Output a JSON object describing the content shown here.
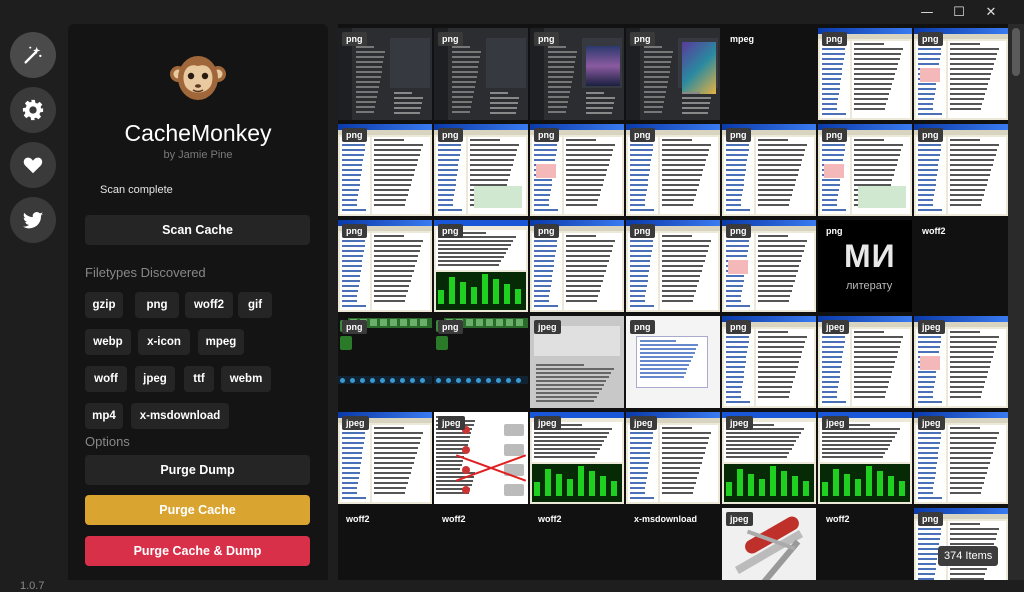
{
  "window": {
    "minimize_label": "—",
    "maximize_label": "☐",
    "close_label": "✕"
  },
  "rail": {
    "items": [
      {
        "name": "magic-wand-icon",
        "glyph": "wand"
      },
      {
        "name": "gear-icon",
        "glyph": "gear"
      },
      {
        "name": "heart-icon",
        "glyph": "heart"
      },
      {
        "name": "twitter-icon",
        "glyph": "bird"
      }
    ],
    "version": "1.0.7"
  },
  "panel": {
    "app_name": "CacheMonkey",
    "byline": "by Jamie Pine",
    "status": "Scan complete",
    "scan_button": "Scan Cache",
    "filetypes_heading": "Filetypes Discovered",
    "filetypes": [
      "gzip",
      "png",
      "woff2",
      "gif",
      "webp",
      "x-icon",
      "mpeg",
      "woff",
      "jpeg",
      "ttf",
      "webm",
      "mp4",
      "x-msdownload"
    ],
    "options_heading": "Options",
    "purge_dump": "Purge Dump",
    "purge_cache": "Purge Cache",
    "purge_cache_dump": "Purge Cache & Dump"
  },
  "colors": {
    "purge_cache_bg": "#d9a530",
    "purge_dump_bg": "#d9304a",
    "panel_bg": "#141414"
  },
  "grid": {
    "rows": [
      [
        {
          "t": "png",
          "k": "dark"
        },
        {
          "t": "png",
          "k": "dark"
        },
        {
          "t": "png",
          "k": "dark"
        },
        {
          "t": "png",
          "k": "dark"
        },
        {
          "t": "mpeg",
          "k": "black"
        },
        {
          "t": "png",
          "k": "xp"
        },
        {
          "t": "png",
          "k": "xp"
        }
      ],
      [
        {
          "t": "png",
          "k": "xp"
        },
        {
          "t": "png",
          "k": "xp"
        },
        {
          "t": "png",
          "k": "xp"
        },
        {
          "t": "png",
          "k": "xp"
        },
        {
          "t": "png",
          "k": "xp"
        },
        {
          "t": "png",
          "k": "xp"
        },
        {
          "t": "png",
          "k": "xp"
        }
      ],
      [
        {
          "t": "png",
          "k": "xp"
        },
        {
          "t": "png",
          "k": "green"
        },
        {
          "t": "png",
          "k": "xp"
        },
        {
          "t": "png",
          "k": "xp"
        },
        {
          "t": "png",
          "k": "xp"
        },
        {
          "t": "png",
          "k": "mi"
        },
        {
          "t": "woff2",
          "k": "black"
        }
      ],
      [
        {
          "t": "png",
          "k": "game"
        },
        {
          "t": "png",
          "k": "game"
        },
        {
          "t": "jpeg",
          "k": "gray"
        },
        {
          "t": "png",
          "k": "light"
        },
        {
          "t": "png",
          "k": "xp"
        },
        {
          "t": "jpeg",
          "k": "xp"
        },
        {
          "t": "jpeg",
          "k": "xp"
        }
      ],
      [
        {
          "t": "jpeg",
          "k": "xp"
        },
        {
          "t": "jpeg",
          "k": "drives"
        },
        {
          "t": "jpeg",
          "k": "green"
        },
        {
          "t": "jpeg",
          "k": "xp"
        },
        {
          "t": "jpeg",
          "k": "green"
        },
        {
          "t": "jpeg",
          "k": "green"
        },
        {
          "t": "jpeg",
          "k": "xp"
        }
      ],
      [
        {
          "t": "woff2",
          "k": "black"
        },
        {
          "t": "woff2",
          "k": "black"
        },
        {
          "t": "woff2",
          "k": "black"
        },
        {
          "t": "x-msdownload",
          "k": "black"
        },
        {
          "t": "jpeg",
          "k": "knife"
        },
        {
          "t": "woff2",
          "k": "black"
        },
        {
          "t": "png",
          "k": "xp"
        }
      ]
    ],
    "mi_text": "МИ",
    "mi_sub": "литерату",
    "item_count": "374 Items"
  }
}
